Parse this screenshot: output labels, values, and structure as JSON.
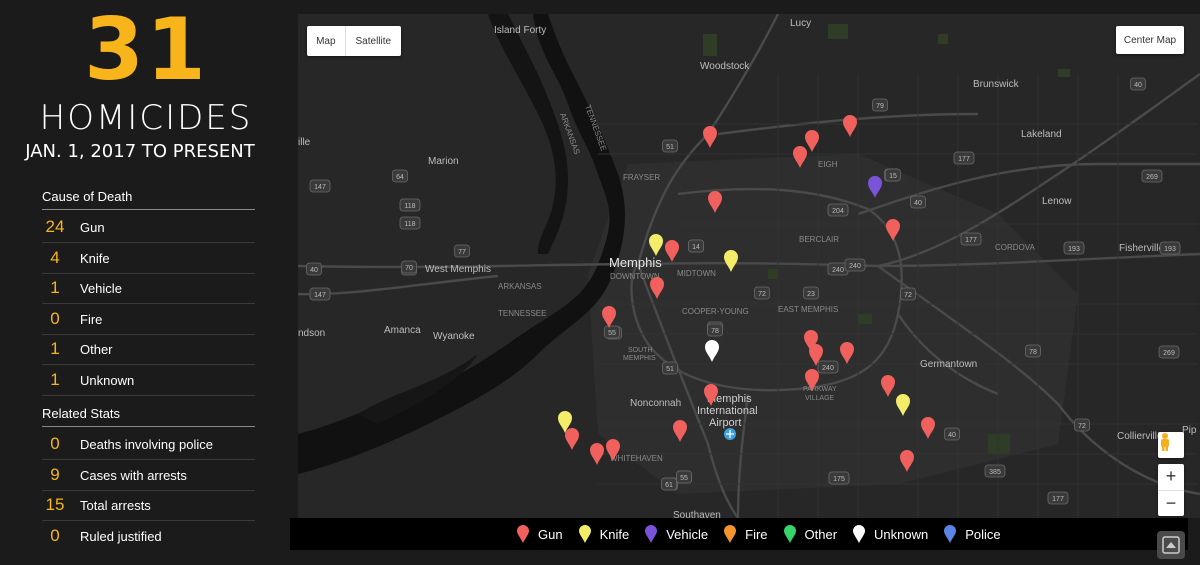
{
  "header": {
    "count": "31",
    "title": "HOMICIDES",
    "daterange": "JAN. 1, 2017 TO PRESENT"
  },
  "cause_of_death": {
    "title": "Cause of Death",
    "rows": [
      {
        "num": "24",
        "label": "Gun"
      },
      {
        "num": "4",
        "label": "Knife"
      },
      {
        "num": "1",
        "label": "Vehicle"
      },
      {
        "num": "0",
        "label": "Fire"
      },
      {
        "num": "1",
        "label": "Other"
      },
      {
        "num": "1",
        "label": "Unknown"
      }
    ]
  },
  "related_stats": {
    "title": "Related Stats",
    "rows": [
      {
        "num": "0",
        "label": "Deaths involving police"
      },
      {
        "num": "9",
        "label": "Cases with arrests"
      },
      {
        "num": "15",
        "label": "Total arrests"
      },
      {
        "num": "0",
        "label": "Ruled justified"
      }
    ]
  },
  "map": {
    "type_controls": {
      "map": "Map",
      "satellite": "Satellite"
    },
    "center_button": "Center Map",
    "zoom_in": "+",
    "zoom_out": "−",
    "labels": {
      "lucy": "Lucy",
      "island_forty": "Island Forty",
      "woodstock": "Woodstock",
      "brunswick": "Brunswick",
      "lakeland": "Lakeland",
      "marion": "Marion",
      "frayser": "FRAYSER",
      "raleigh": "EIGH",
      "lenow": "Lenow",
      "berclair": "BERCLAIR",
      "cordova": "CORDOVA",
      "fisherville": "Fisherville",
      "memphis": "Memphis",
      "downtown": "DOWNTOWN",
      "midtown": "MIDTOWN",
      "west_memphis": "West Memphis",
      "arkansas": "ARKANSAS",
      "arkansas_v": "ARKANSAS",
      "tennessee_v": "TENNESSEE",
      "tennessee": "TENNESSEE",
      "cooper_young": "COOPER-YOUNG",
      "east_memphis": "EAST MEMPHIS",
      "amanca": "Amanca",
      "wyanoke": "Wyanoke",
      "south_memphis_1": "SOUTH",
      "south_memphis_2": "MEMPHIS",
      "germantown": "Germantown",
      "nonconnah": "Nonconnah",
      "parkway_1": "PARKWAY",
      "parkway_2": "VILLAGE",
      "airport_1": "Memphis",
      "airport_2": "International",
      "airport_3": "Airport",
      "whitehaven": "WHITEHAVEN",
      "southaven": "Southaven",
      "collierville": "Collierville",
      "ille": "ille",
      "ndson": "ndson",
      "pip": "Pip"
    },
    "shields": [
      "51",
      "40",
      "240",
      "79",
      "70",
      "64",
      "118",
      "118",
      "147",
      "77",
      "40",
      "70",
      "147",
      "14",
      "78",
      "55",
      "55",
      "51",
      "61",
      "240",
      "40",
      "72",
      "23",
      "72",
      "78",
      "177",
      "177",
      "240",
      "14",
      "204",
      "15",
      "385",
      "78",
      "175",
      "55",
      "55",
      "61",
      "177",
      "193",
      "40",
      "269",
      "269",
      "193",
      "72",
      "175",
      "15"
    ]
  },
  "legend": {
    "items": [
      {
        "label": "Gun",
        "color": "#f0605d"
      },
      {
        "label": "Knife",
        "color": "#f3ec68"
      },
      {
        "label": "Vehicle",
        "color": "#7a53d8"
      },
      {
        "label": "Fire",
        "color": "#f39528"
      },
      {
        "label": "Other",
        "color": "#36d36b"
      },
      {
        "label": "Unknown",
        "color": "#ffffff"
      },
      {
        "label": "Police",
        "color": "#5b84e6"
      }
    ]
  },
  "colors": {
    "accent": "#f7b51b",
    "gun": "#f0605d",
    "knife": "#f3ec68",
    "vehicle": "#7a53d8",
    "unknown": "#ffffff"
  }
}
